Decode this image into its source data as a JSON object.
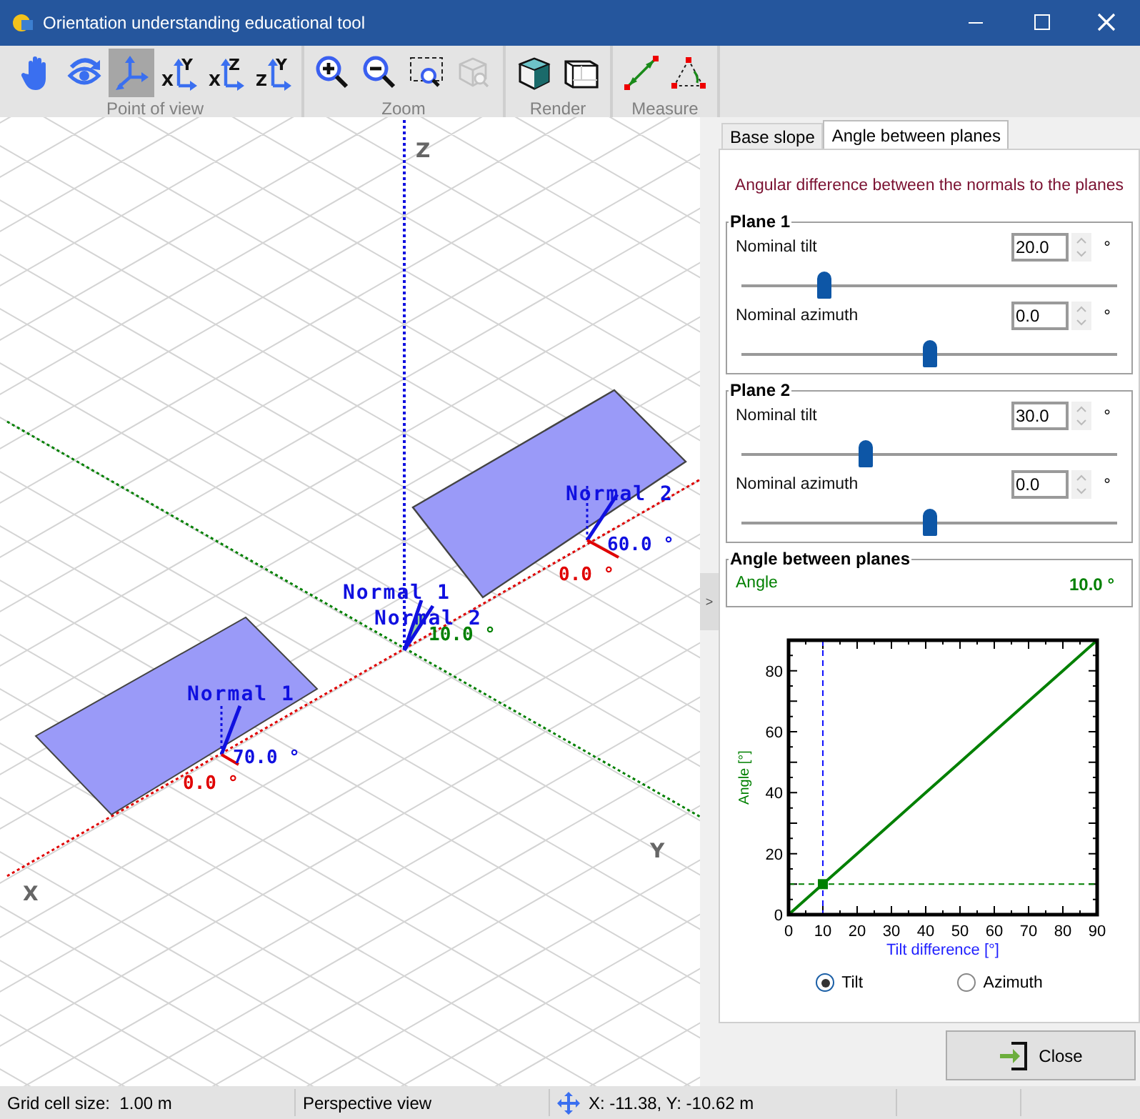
{
  "window": {
    "title": "Orientation understanding educational tool"
  },
  "toolbar": {
    "groups": [
      {
        "label": "Point of view",
        "buttons": [
          {
            "kind": "pan",
            "selected": false,
            "disabled": false
          },
          {
            "kind": "orbit",
            "selected": false,
            "disabled": false
          },
          {
            "kind": "axes",
            "selected": true,
            "disabled": false
          },
          {
            "kind": "plane-view",
            "letters": [
              "X",
              "Y"
            ],
            "selected": false,
            "disabled": false
          },
          {
            "kind": "plane-view",
            "letters": [
              "X",
              "Z"
            ],
            "selected": false,
            "disabled": false
          },
          {
            "kind": "plane-view",
            "letters": [
              "Z",
              "Y"
            ],
            "selected": false,
            "disabled": false
          }
        ]
      },
      {
        "label": "Zoom",
        "buttons": [
          {
            "kind": "zoom-in",
            "selected": false,
            "disabled": false
          },
          {
            "kind": "zoom-out",
            "selected": false,
            "disabled": false
          },
          {
            "kind": "zoom-box",
            "selected": false,
            "disabled": false
          },
          {
            "kind": "zoom-fit",
            "selected": false,
            "disabled": true
          }
        ]
      },
      {
        "label": "Render",
        "buttons": [
          {
            "kind": "solid",
            "selected": false,
            "disabled": false
          },
          {
            "kind": "wire",
            "selected": false,
            "disabled": false
          }
        ]
      },
      {
        "label": "Measure",
        "buttons": [
          {
            "kind": "distance",
            "selected": false,
            "disabled": false
          },
          {
            "kind": "angle",
            "selected": false,
            "disabled": false
          }
        ]
      }
    ]
  },
  "viewport": {
    "axis_labels": [
      "Z",
      "Y",
      "X"
    ],
    "annotations": [
      {
        "kind": "normal",
        "text": "Normal 2"
      },
      {
        "kind": "tilt",
        "text": "60.0 °"
      },
      {
        "kind": "azimuth",
        "text": "0.0 °"
      },
      {
        "kind": "normal",
        "text": "Normal 1"
      },
      {
        "kind": "normal",
        "text": "Normal 2"
      },
      {
        "kind": "difference",
        "text": "10.0 °"
      },
      {
        "kind": "normal",
        "text": "Normal 1"
      },
      {
        "kind": "tilt",
        "text": "70.0 °"
      },
      {
        "kind": "azimuth",
        "text": "0.0 °"
      }
    ]
  },
  "collapse_handle": ">",
  "panel": {
    "tabs": [
      {
        "label": "Base slope",
        "selected": false
      },
      {
        "label": "Angle between planes",
        "selected": true
      }
    ],
    "description": "Angular difference between the normals to the planes",
    "planes": [
      {
        "title": "Plane 1",
        "rows": [
          {
            "label": "Nominal tilt",
            "value": "20.0",
            "unit": "°",
            "level": 0.22
          },
          {
            "label": "Nominal azimuth",
            "value": "0.0",
            "unit": "°",
            "level": 0.5
          }
        ]
      },
      {
        "title": "Plane 2",
        "rows": [
          {
            "label": "Nominal tilt",
            "value": "30.0",
            "unit": "°",
            "level": 0.33
          },
          {
            "label": "Nominal azimuth",
            "value": "0.0",
            "unit": "°",
            "level": 0.5
          }
        ]
      }
    ],
    "result": {
      "title": "Angle between planes",
      "label": "Angle",
      "value": "10.0 °"
    },
    "chart_data": {
      "type": "line",
      "xlabel": "Tilt difference [°]",
      "ylabel": "Angle [°]",
      "x": [
        0,
        10,
        20,
        30,
        40,
        50,
        60,
        70,
        80,
        90
      ],
      "series": [
        {
          "color": "#008000",
          "values": [
            0,
            10,
            20,
            30,
            40,
            50,
            60,
            70,
            80,
            90
          ]
        }
      ],
      "xlim": [
        0,
        90
      ],
      "ylim": [
        0,
        90
      ],
      "xticks": [
        0,
        10,
        20,
        30,
        40,
        50,
        60,
        70,
        80,
        90
      ],
      "yticks": [
        0,
        20,
        40,
        60,
        80
      ],
      "ref_lines": [
        {
          "axis": "x",
          "value": 10,
          "color": "#1010ff"
        },
        {
          "axis": "y",
          "value": 10,
          "color": "#008000"
        }
      ]
    },
    "modes": [
      {
        "label": "Tilt",
        "selected": true
      },
      {
        "label": "Azimuth",
        "selected": false
      }
    ],
    "close_button": "Close"
  },
  "status_bar": {
    "grid": "Grid cell size:  1.00 m",
    "view": "Perspective view",
    "coords": "X: -11.38, Y: -10.62 m"
  }
}
